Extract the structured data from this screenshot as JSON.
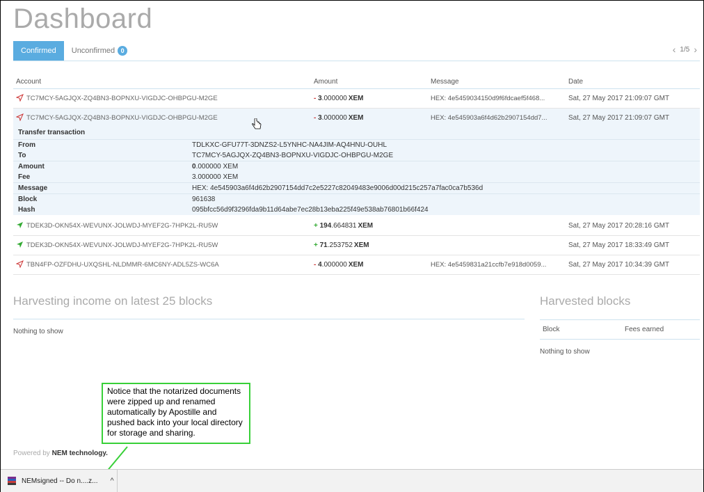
{
  "page": {
    "title": "Dashboard"
  },
  "tabs": [
    {
      "label": "Confirmed",
      "active": true
    },
    {
      "label": "Unconfirmed",
      "badge": "0"
    }
  ],
  "pager": {
    "text": "1/5"
  },
  "table": {
    "headers": [
      "Account",
      "Amount",
      "Message",
      "Date"
    ],
    "rows": [
      {
        "direction": "out",
        "account": "TC7MCY-5AGJQX-ZQ4BN3-BOPNXU-VIGDJC-OHBPGU-M2GE",
        "sign": "- ",
        "int": "3",
        "dec": ".000000",
        "unit": "XEM",
        "message": "HEX: 4e5459034150d9f6fdcaef5f468...",
        "date": "Sat, 27 May 2017 21:09:07 GMT"
      },
      {
        "direction": "out",
        "account": "TC7MCY-5AGJQX-ZQ4BN3-BOPNXU-VIGDJC-OHBPGU-M2GE",
        "sign": "- ",
        "int": "3",
        "dec": ".000000",
        "unit": "XEM",
        "message": "HEX: 4e545903a6f4d62b2907154dd7...",
        "date": "Sat, 27 May 2017 21:09:07 GMT"
      },
      {
        "direction": "in",
        "account": "TDEK3D-OKN54X-WEVUNX-JOLWDJ-MYEF2G-7HPK2L-RU5W",
        "sign": "+ ",
        "int": "194",
        "dec": ".664831",
        "unit": "XEM",
        "message": "",
        "date": "Sat, 27 May 2017 20:28:16 GMT"
      },
      {
        "direction": "in",
        "account": "TDEK3D-OKN54X-WEVUNX-JOLWDJ-MYEF2G-7HPK2L-RU5W",
        "sign": "+ ",
        "int": "71",
        "dec": ".253752",
        "unit": "XEM",
        "message": "",
        "date": "Sat, 27 May 2017 18:33:49 GMT"
      },
      {
        "direction": "out",
        "account": "TBN4FP-OZFDHU-UXQSHL-NLDMMR-6MC6NY-ADL5ZS-WC6A",
        "sign": "- ",
        "int": "4",
        "dec": ".000000",
        "unit": "XEM",
        "message": "HEX: 4e5459831a21ccfb7e918d0059...",
        "date": "Sat, 27 May 2017 10:34:39 GMT"
      }
    ]
  },
  "detail": {
    "title": "Transfer transaction",
    "from_label": "From",
    "from": "TDLKXC-GFU77T-3DNZS2-L5YNHC-NA4JIM-AQ4HNU-OUHL",
    "to_label": "To",
    "to": "TC7MCY-5AGJQX-ZQ4BN3-BOPNXU-VIGDJC-OHBPGU-M2GE",
    "amount_label": "Amount",
    "amount_int": "0",
    "amount_dec": ".000000 XEM",
    "fee_label": "Fee",
    "fee": "3.000000 XEM",
    "message_label": "Message",
    "message": "HEX: 4e545903a6f4d62b2907154dd7c2e5227c82049483e9006d00d215c257a7fac0ca7b536d",
    "block_label": "Block",
    "block": "961638",
    "hash_label": "Hash",
    "hash": "095bfcc56d9f3296fda9b11d64abe7ec28b13eba225f49e538ab76801b66f424"
  },
  "harvest_income": {
    "title": "Harvesting income on latest 25 blocks",
    "empty": "Nothing to show"
  },
  "harvested_blocks": {
    "title": "Harvested blocks",
    "col_block": "Block",
    "col_fees": "Fees earned",
    "empty": "Nothing to show"
  },
  "callout": {
    "text": "Notice that the notarized documents were zipped up and renamed automatically by Apostille and pushed back into your local directory for storage and sharing."
  },
  "footer": {
    "prefix": "Powered by ",
    "brand": "NEM technology."
  },
  "download": {
    "filename": "NEMsigned -- Do n....z...",
    "chevron": "^"
  },
  "colors": {
    "accent": "#5aace0",
    "outgoing": "#cc3333",
    "incoming": "#33aa33",
    "callout_border": "#38d038"
  }
}
